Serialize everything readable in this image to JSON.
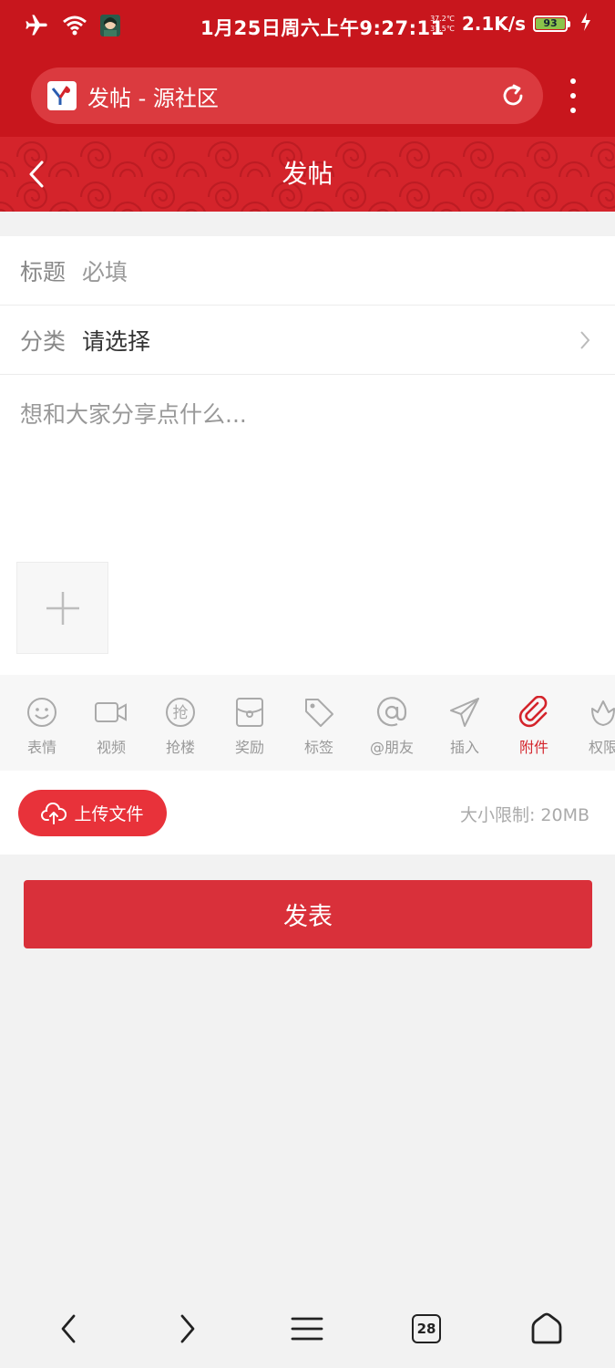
{
  "status_bar": {
    "time": "1月25日周六上午9:27:11",
    "temp_top": "37.2℃",
    "temp_bottom": "37.5℃",
    "net_speed": "2.1K/s",
    "battery": "93",
    "icons": [
      "airplane-icon",
      "wifi-icon",
      "avatar-icon",
      "charging-icon"
    ]
  },
  "browser": {
    "tab_title": "发帖 - 源社区",
    "icons": [
      "site-favicon",
      "reload-icon",
      "more-icon"
    ]
  },
  "header": {
    "title": "发帖",
    "accent_color": "#d4242b"
  },
  "form": {
    "title_label": "标题",
    "title_placeholder": "必填",
    "category_label": "分类",
    "category_value": "请选择",
    "content_placeholder": "想和大家分享点什么..."
  },
  "toolbar": {
    "items": [
      {
        "label": "表情",
        "icon": "emoji-icon"
      },
      {
        "label": "视频",
        "icon": "video-icon"
      },
      {
        "label": "抢楼",
        "icon": "grab-floor-icon"
      },
      {
        "label": "奖励",
        "icon": "reward-icon"
      },
      {
        "label": "标签",
        "icon": "tag-icon"
      },
      {
        "label": "@朋友",
        "icon": "at-icon"
      },
      {
        "label": "插入",
        "icon": "send-icon"
      },
      {
        "label": "附件",
        "icon": "attachment-icon",
        "active": true
      },
      {
        "label": "权限",
        "icon": "permission-icon"
      }
    ]
  },
  "attachment": {
    "upload_label": "上传文件",
    "size_limit": "大小限制: 20MB"
  },
  "submit": {
    "label": "发表"
  },
  "bottom_nav": {
    "tab_count": "28",
    "icons": [
      "back-icon",
      "forward-icon",
      "menu-icon",
      "tabs-icon",
      "home-icon"
    ]
  }
}
